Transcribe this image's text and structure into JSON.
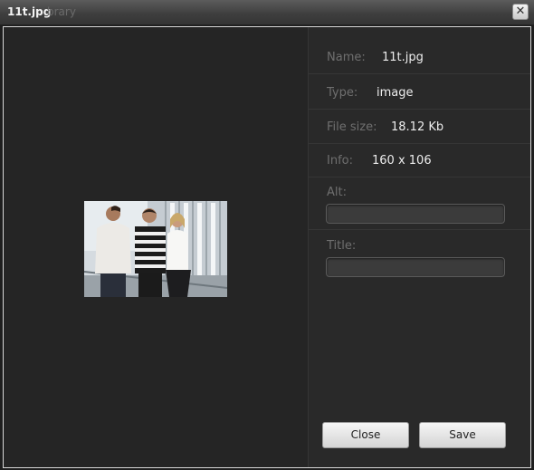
{
  "window": {
    "title": "11t.jpg",
    "title_ghost": "brary",
    "close_glyph": "✕"
  },
  "details": {
    "name_label": "Name:",
    "name_value": "11t.jpg",
    "type_label": "Type:",
    "type_value": "image",
    "size_label": "File size:",
    "size_value": "18.12 Kb",
    "info_label": "Info:",
    "info_value": "160 x 106",
    "alt_label": "Alt:",
    "alt_value": "",
    "title_label": "Title:",
    "title_value": ""
  },
  "buttons": {
    "close_label": "Close",
    "save_label": "Save"
  }
}
